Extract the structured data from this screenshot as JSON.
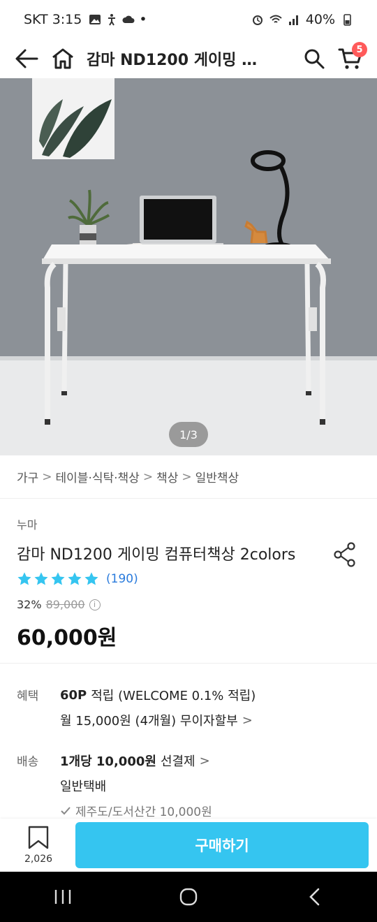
{
  "status_bar": {
    "carrier_time": "SKT 3:15",
    "dot": "•",
    "battery": "40%",
    "icons": [
      "image-icon",
      "accessibility-icon",
      "cloud-icon",
      "alarm-icon",
      "wifi-icon",
      "signal-icon",
      "battery-icon"
    ]
  },
  "nav": {
    "title": "감마 ND1200 게이밍 …",
    "cart_badge": "5",
    "icons": [
      "back-arrow-icon",
      "home-icon",
      "search-icon",
      "cart-icon"
    ]
  },
  "hero": {
    "page_indicator": "1/3"
  },
  "breadcrumb": {
    "items": [
      "가구",
      "테이블·식탁·책상",
      "책상",
      "일반책상"
    ],
    "separator": ">"
  },
  "product": {
    "brand": "누마",
    "title": "감마 ND1200 게이밍 컴퓨터책상 2colors",
    "rating_stars": 5,
    "review_count": "(190)",
    "discount_rate": "32%",
    "original_price": "89,000",
    "info_symbol": "i",
    "price": "60,000원",
    "star_color": "#35c5f0"
  },
  "benefits": {
    "benefit_label": "혜택",
    "points": "60P",
    "points_suffix": "적립 (WELCOME 0.1% 적립)",
    "installment": "월 15,000원 (4개월) 무이자할부",
    "shipping_label": "배송",
    "shipping_fee": "1개당 10,000원",
    "shipping_prepaid": "선결제",
    "shipping_type": "일반택배",
    "shipping_note": "제주도/도서산간 10,000원",
    "chevron": ">"
  },
  "bottom": {
    "wish_count": "2,026",
    "buy_label": "구매하기",
    "accent": "#35c5f0"
  },
  "system_nav": {
    "icons": [
      "recents-icon",
      "home-circle-icon",
      "back-chevron-icon"
    ]
  }
}
